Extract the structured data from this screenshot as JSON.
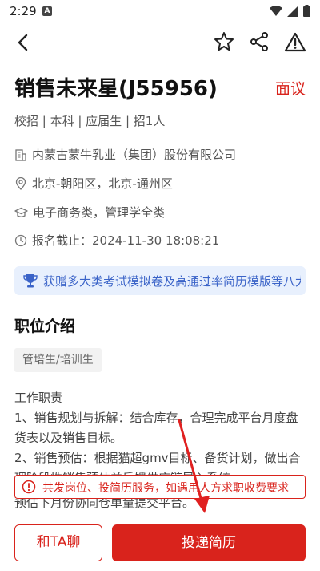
{
  "status": {
    "time": "2:29",
    "notif_letter": "A"
  },
  "job": {
    "title": "销售未来星(J55956)",
    "salary": "面议",
    "tags": "校招 | 本科 | 应届生 | 招1人",
    "company": "内蒙古蒙牛乳业（集团）股份有限公司",
    "location": "北京-朝阳区，北京-通州区",
    "major": "电子商务类，管理学全类",
    "deadline": "报名截止：2024-11-30 18:08:21"
  },
  "banner": {
    "text": "获赠多大类考试模拟卷及高通过率简历模版等八大"
  },
  "section": {
    "title": "职位介绍",
    "chip": "管培生/培训生"
  },
  "description": [
    "工作职责",
    "1、销售规划与拆解：结合库存，合理完成平台月度盘货表以及销售目标。",
    "2、销售预估：根据猫超gmv目标、备货计划，做出合理阶段性销售预估并反馈供应链导入系统。",
    "预估下月份协同仓单量提交平台。"
  ],
  "toast": {
    "text": "共发岗位、投简历服务，如遇用人方求职收费要求"
  },
  "actions": {
    "chat": "和TA聊",
    "apply": "投递简历"
  },
  "colors": {
    "accent": "#d9231c",
    "banner_bg": "#e8f0fd",
    "banner_text": "#3a63c8"
  }
}
